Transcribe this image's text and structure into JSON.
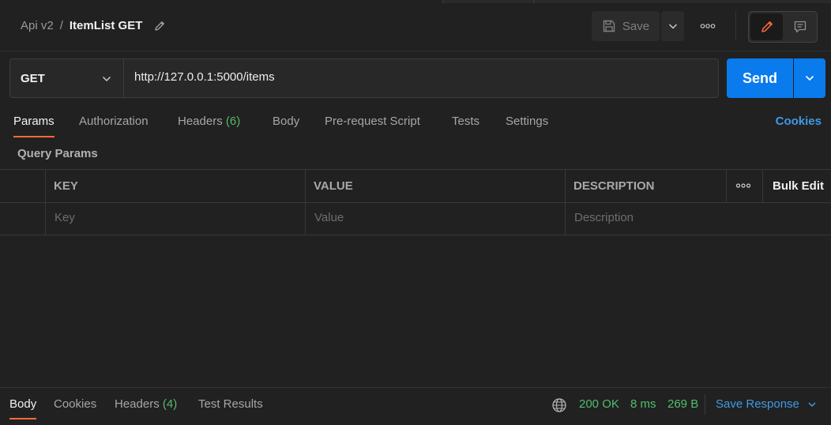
{
  "header": {
    "collection": "Api v2",
    "separator": "/",
    "request_name": "ItemList GET",
    "save_label": "Save"
  },
  "request": {
    "method": "GET",
    "url": "http://127.0.0.1:5000/items",
    "send_label": "Send"
  },
  "tabs": [
    {
      "label": "Params"
    },
    {
      "label": "Authorization"
    },
    {
      "label": "Headers",
      "count": "(6)"
    },
    {
      "label": "Body"
    },
    {
      "label": "Pre-request Script"
    },
    {
      "label": "Tests"
    },
    {
      "label": "Settings"
    }
  ],
  "cookies_label": "Cookies",
  "query_params": {
    "title": "Query Params",
    "columns": [
      "KEY",
      "VALUE",
      "DESCRIPTION"
    ],
    "placeholders": [
      "Key",
      "Value",
      "Description"
    ],
    "bulk_edit": "Bulk Edit"
  },
  "response": {
    "tabs": [
      {
        "label": "Body"
      },
      {
        "label": "Cookies"
      },
      {
        "label": "Headers",
        "count": "(4)"
      },
      {
        "label": "Test Results"
      }
    ],
    "status": "200 OK",
    "time": "8 ms",
    "size": "269 B",
    "save_response": "Save Response"
  },
  "colors": {
    "accent": "#ff6c37",
    "send": "#097bed",
    "link": "#3f9ae7",
    "success": "#4fbf6e"
  },
  "icons": [
    "pencil-icon",
    "save-icon",
    "chevron-down-icon",
    "more-icon",
    "edit-icon",
    "comment-icon",
    "globe-icon"
  ]
}
